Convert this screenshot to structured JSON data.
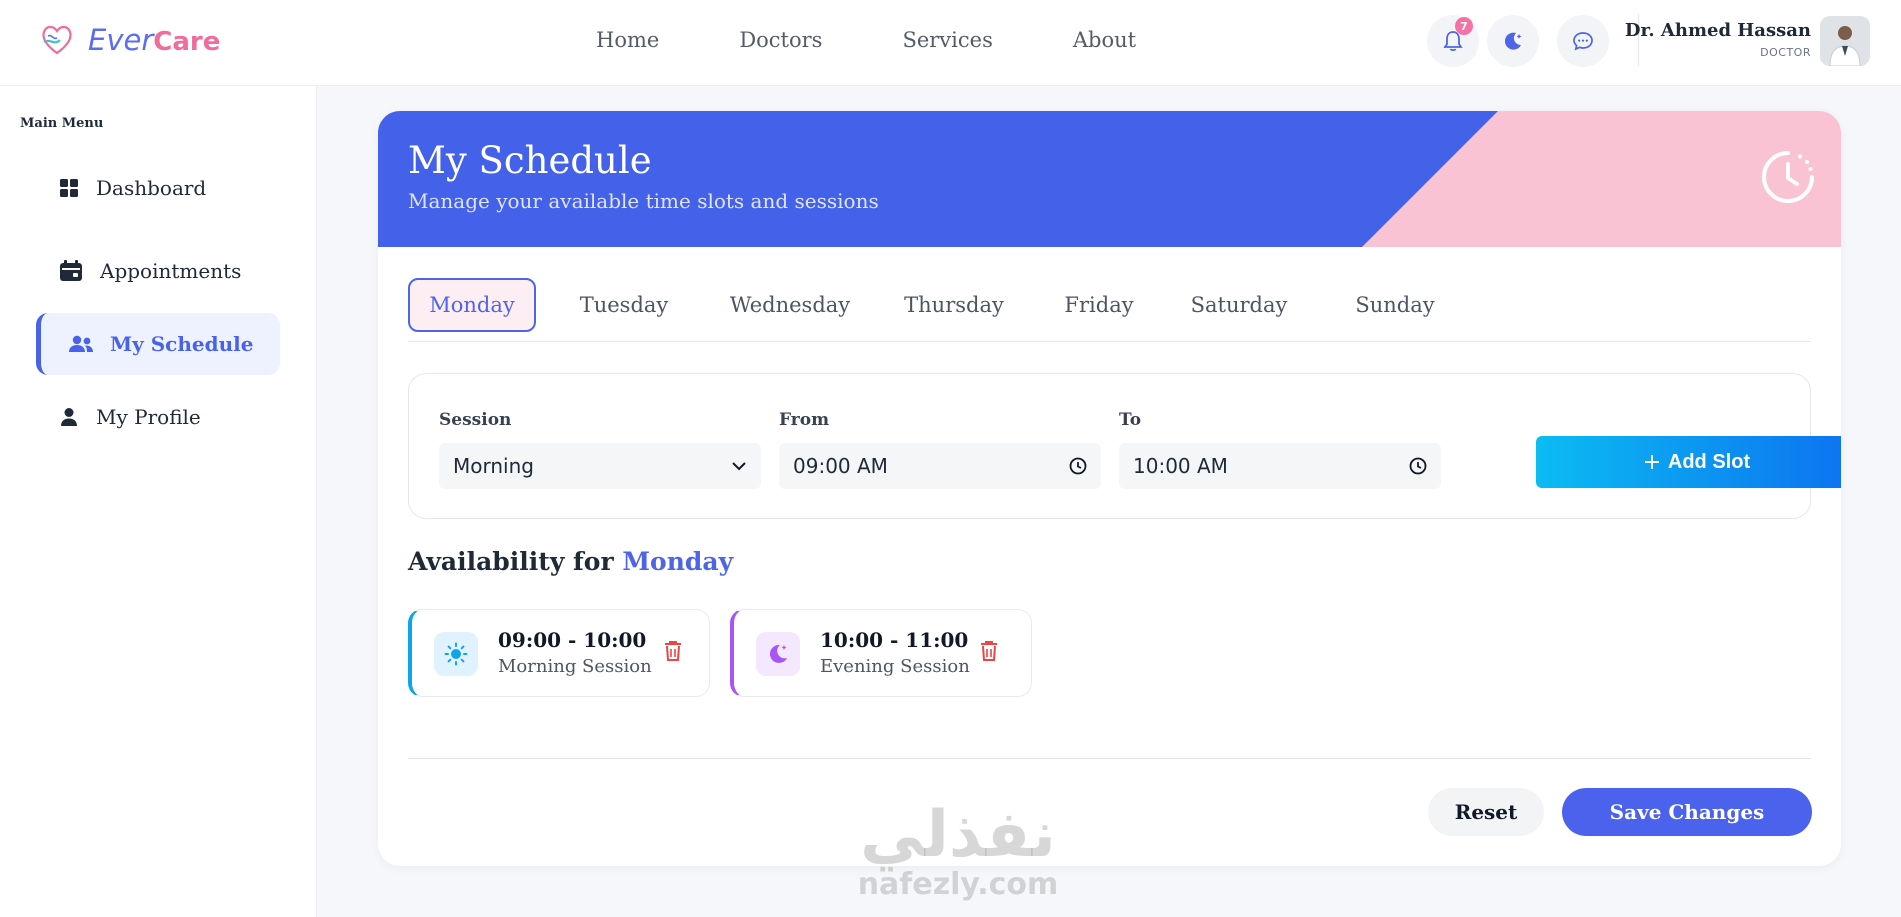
{
  "brand": {
    "ever": "Ever",
    "care": "Care"
  },
  "nav": [
    "Home",
    "Doctors",
    "Services",
    "About"
  ],
  "notifications": {
    "count": "7"
  },
  "user": {
    "name": "Dr. Ahmed Hassan",
    "role": "DOCTOR"
  },
  "sidebar": {
    "title": "Main Menu",
    "items": [
      {
        "label": "Dashboard",
        "icon": "grid-icon"
      },
      {
        "label": "Appointments",
        "icon": "calendar-icon"
      },
      {
        "label": "My Schedule",
        "icon": "users-icon",
        "active": true
      },
      {
        "label": "My Profile",
        "icon": "user-icon"
      }
    ]
  },
  "page": {
    "title": "My Schedule",
    "subtitle": "Manage your available time slots and sessions"
  },
  "tabs": [
    "Monday",
    "Tuesday",
    "Wednesday",
    "Thursday",
    "Friday",
    "Saturday",
    "Sunday"
  ],
  "active_tab": "Monday",
  "form": {
    "session_label": "Session",
    "session_value": "Morning",
    "from_label": "From",
    "from_value": "09:00 AM",
    "to_label": "To",
    "to_value": "10:00 AM",
    "add_label": "Add Slot"
  },
  "availability": {
    "prefix": "Availability for",
    "day": "Monday"
  },
  "slots": [
    {
      "time": "09:00 - 10:00",
      "session": "Morning Session",
      "icon": "sun-icon",
      "color": "#0ea5e9"
    },
    {
      "time": "10:00 - 11:00",
      "session": "Evening Session",
      "icon": "moon-icon",
      "color": "#a855f7"
    }
  ],
  "actions": {
    "reset": "Reset",
    "save": "Save Changes"
  },
  "colors": {
    "primary": "#4461ea",
    "pink": "#f9c3d3",
    "danger": "#ef4444"
  },
  "watermark": {
    "arabic": "نفذلي",
    "latin": "nafezly.com"
  }
}
